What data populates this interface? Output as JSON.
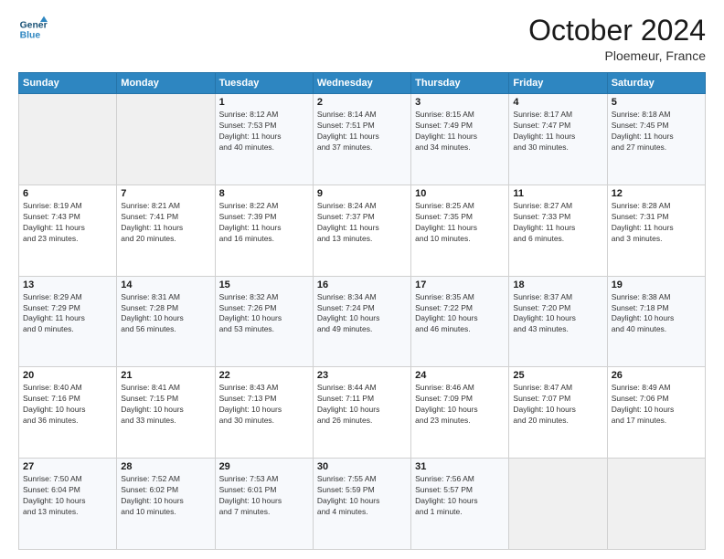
{
  "logo": {
    "line1": "General",
    "line2": "Blue"
  },
  "title": "October 2024",
  "location": "Ploemeur, France",
  "headers": [
    "Sunday",
    "Monday",
    "Tuesday",
    "Wednesday",
    "Thursday",
    "Friday",
    "Saturday"
  ],
  "weeks": [
    [
      {
        "day": "",
        "info": ""
      },
      {
        "day": "",
        "info": ""
      },
      {
        "day": "1",
        "info": "Sunrise: 8:12 AM\nSunset: 7:53 PM\nDaylight: 11 hours\nand 40 minutes."
      },
      {
        "day": "2",
        "info": "Sunrise: 8:14 AM\nSunset: 7:51 PM\nDaylight: 11 hours\nand 37 minutes."
      },
      {
        "day": "3",
        "info": "Sunrise: 8:15 AM\nSunset: 7:49 PM\nDaylight: 11 hours\nand 34 minutes."
      },
      {
        "day": "4",
        "info": "Sunrise: 8:17 AM\nSunset: 7:47 PM\nDaylight: 11 hours\nand 30 minutes."
      },
      {
        "day": "5",
        "info": "Sunrise: 8:18 AM\nSunset: 7:45 PM\nDaylight: 11 hours\nand 27 minutes."
      }
    ],
    [
      {
        "day": "6",
        "info": "Sunrise: 8:19 AM\nSunset: 7:43 PM\nDaylight: 11 hours\nand 23 minutes."
      },
      {
        "day": "7",
        "info": "Sunrise: 8:21 AM\nSunset: 7:41 PM\nDaylight: 11 hours\nand 20 minutes."
      },
      {
        "day": "8",
        "info": "Sunrise: 8:22 AM\nSunset: 7:39 PM\nDaylight: 11 hours\nand 16 minutes."
      },
      {
        "day": "9",
        "info": "Sunrise: 8:24 AM\nSunset: 7:37 PM\nDaylight: 11 hours\nand 13 minutes."
      },
      {
        "day": "10",
        "info": "Sunrise: 8:25 AM\nSunset: 7:35 PM\nDaylight: 11 hours\nand 10 minutes."
      },
      {
        "day": "11",
        "info": "Sunrise: 8:27 AM\nSunset: 7:33 PM\nDaylight: 11 hours\nand 6 minutes."
      },
      {
        "day": "12",
        "info": "Sunrise: 8:28 AM\nSunset: 7:31 PM\nDaylight: 11 hours\nand 3 minutes."
      }
    ],
    [
      {
        "day": "13",
        "info": "Sunrise: 8:29 AM\nSunset: 7:29 PM\nDaylight: 11 hours\nand 0 minutes."
      },
      {
        "day": "14",
        "info": "Sunrise: 8:31 AM\nSunset: 7:28 PM\nDaylight: 10 hours\nand 56 minutes."
      },
      {
        "day": "15",
        "info": "Sunrise: 8:32 AM\nSunset: 7:26 PM\nDaylight: 10 hours\nand 53 minutes."
      },
      {
        "day": "16",
        "info": "Sunrise: 8:34 AM\nSunset: 7:24 PM\nDaylight: 10 hours\nand 49 minutes."
      },
      {
        "day": "17",
        "info": "Sunrise: 8:35 AM\nSunset: 7:22 PM\nDaylight: 10 hours\nand 46 minutes."
      },
      {
        "day": "18",
        "info": "Sunrise: 8:37 AM\nSunset: 7:20 PM\nDaylight: 10 hours\nand 43 minutes."
      },
      {
        "day": "19",
        "info": "Sunrise: 8:38 AM\nSunset: 7:18 PM\nDaylight: 10 hours\nand 40 minutes."
      }
    ],
    [
      {
        "day": "20",
        "info": "Sunrise: 8:40 AM\nSunset: 7:16 PM\nDaylight: 10 hours\nand 36 minutes."
      },
      {
        "day": "21",
        "info": "Sunrise: 8:41 AM\nSunset: 7:15 PM\nDaylight: 10 hours\nand 33 minutes."
      },
      {
        "day": "22",
        "info": "Sunrise: 8:43 AM\nSunset: 7:13 PM\nDaylight: 10 hours\nand 30 minutes."
      },
      {
        "day": "23",
        "info": "Sunrise: 8:44 AM\nSunset: 7:11 PM\nDaylight: 10 hours\nand 26 minutes."
      },
      {
        "day": "24",
        "info": "Sunrise: 8:46 AM\nSunset: 7:09 PM\nDaylight: 10 hours\nand 23 minutes."
      },
      {
        "day": "25",
        "info": "Sunrise: 8:47 AM\nSunset: 7:07 PM\nDaylight: 10 hours\nand 20 minutes."
      },
      {
        "day": "26",
        "info": "Sunrise: 8:49 AM\nSunset: 7:06 PM\nDaylight: 10 hours\nand 17 minutes."
      }
    ],
    [
      {
        "day": "27",
        "info": "Sunrise: 7:50 AM\nSunset: 6:04 PM\nDaylight: 10 hours\nand 13 minutes."
      },
      {
        "day": "28",
        "info": "Sunrise: 7:52 AM\nSunset: 6:02 PM\nDaylight: 10 hours\nand 10 minutes."
      },
      {
        "day": "29",
        "info": "Sunrise: 7:53 AM\nSunset: 6:01 PM\nDaylight: 10 hours\nand 7 minutes."
      },
      {
        "day": "30",
        "info": "Sunrise: 7:55 AM\nSunset: 5:59 PM\nDaylight: 10 hours\nand 4 minutes."
      },
      {
        "day": "31",
        "info": "Sunrise: 7:56 AM\nSunset: 5:57 PM\nDaylight: 10 hours\nand 1 minute."
      },
      {
        "day": "",
        "info": ""
      },
      {
        "day": "",
        "info": ""
      }
    ]
  ]
}
